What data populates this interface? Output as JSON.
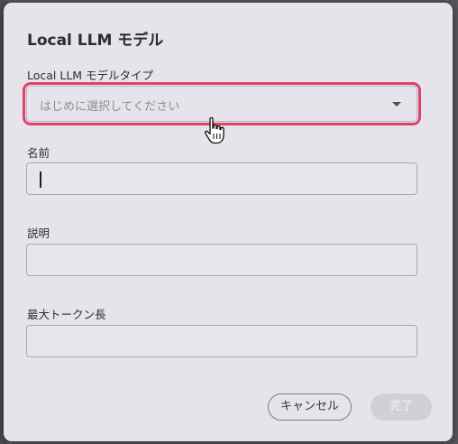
{
  "dialog": {
    "title": "Local LLM モデル",
    "model_type": {
      "label": "Local LLM モデルタイプ",
      "placeholder": "はじめに選択してください"
    },
    "name": {
      "label": "名前",
      "value": ""
    },
    "description": {
      "label": "説明",
      "value": ""
    },
    "max_tokens": {
      "label": "最大トークン長",
      "value": ""
    },
    "buttons": {
      "cancel_label": "キャンセル",
      "done_label": "完了"
    }
  },
  "colors": {
    "dialog_bg": "#e6e4ea",
    "focus_ring": "#e0406a",
    "done_disabled_bg": "#d2d0d7"
  },
  "icons": {
    "dropdown": "chevron-down-icon",
    "cursor": "hand-pointer-icon"
  }
}
